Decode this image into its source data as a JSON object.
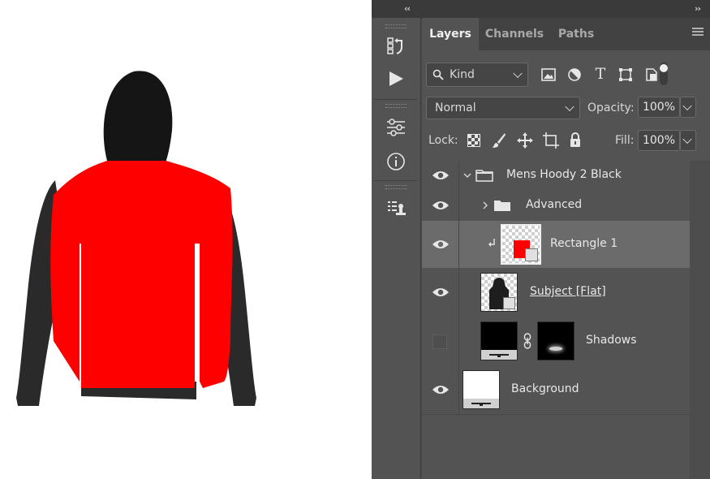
{
  "canvas": {
    "fill_color": "#ff0000",
    "hoodie_color": "#2b2b2b"
  },
  "panel": {
    "tabs": [
      {
        "label": "Layers",
        "active": true
      },
      {
        "label": "Channels",
        "active": false
      },
      {
        "label": "Paths",
        "active": false
      }
    ],
    "filter": {
      "label": "Kind"
    },
    "blend_mode": "Normal",
    "opacity_label": "Opacity:",
    "opacity_value": "100%",
    "lock_label": "Lock:",
    "fill_label": "Fill:",
    "fill_value": "100%"
  },
  "layers": [
    {
      "name": "Mens Hoody 2 Black",
      "type": "group",
      "expanded": true,
      "visible": true
    },
    {
      "name": "Advanced",
      "type": "group",
      "expanded": false,
      "visible": true
    },
    {
      "name": "Rectangle 1",
      "type": "smart-object",
      "clipped": true,
      "selected": true,
      "visible": true
    },
    {
      "name": "Subject [Flat]",
      "type": "smart-object",
      "visible": true
    },
    {
      "name": "Shadows",
      "type": "layer-with-mask",
      "visible": false
    },
    {
      "name": "Background",
      "type": "layer",
      "visible": true
    }
  ],
  "icons": [
    "history-icon",
    "actions-play-icon",
    "adjustments-icon",
    "info-icon",
    "layer-comps-icon",
    "search-icon",
    "image-filter-icon",
    "adjustment-filter-icon",
    "type-filter-icon",
    "shape-filter-icon",
    "smart-object-filter-icon",
    "filter-toggle-icon",
    "lock-transparent-icon",
    "lock-paint-icon",
    "lock-position-icon",
    "lock-artboard-icon",
    "lock-all-icon",
    "eye-icon",
    "folder-icon",
    "link-icon"
  ]
}
